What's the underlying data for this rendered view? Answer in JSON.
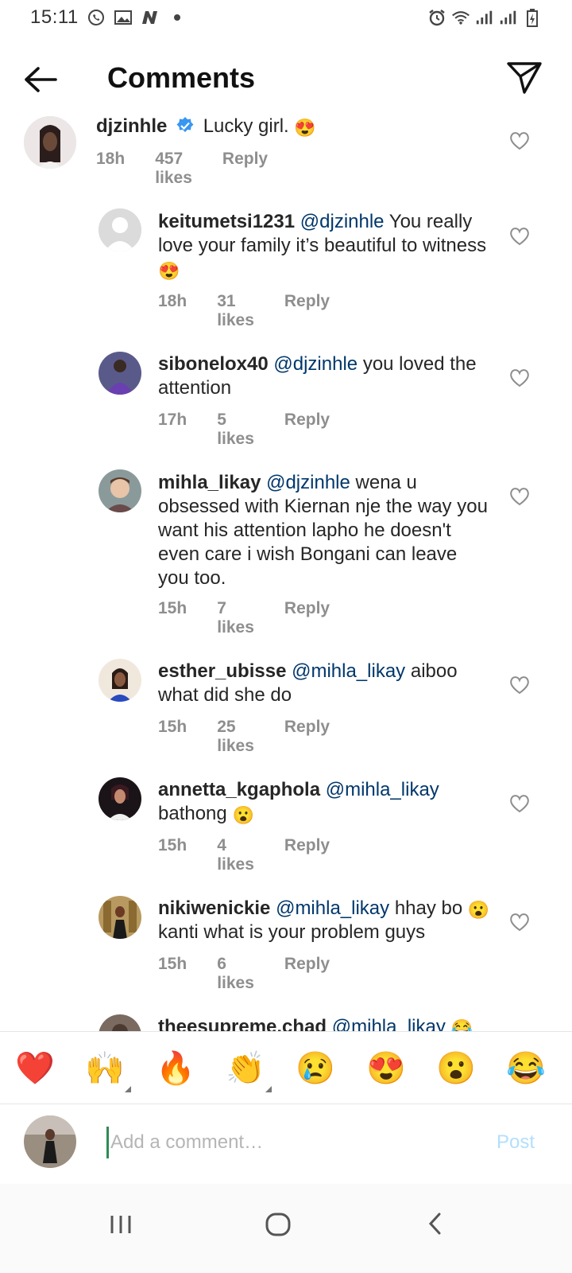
{
  "status": {
    "time": "15:11",
    "left_icons": [
      "whatsapp-icon",
      "gallery-icon",
      "news-icon",
      "dot-icon"
    ],
    "right_icons": [
      "alarm-icon",
      "wifi-icon",
      "signal-icon",
      "signal-icon",
      "battery-icon"
    ]
  },
  "header": {
    "title": "Comments"
  },
  "comments": [
    {
      "username": "djzinhle",
      "verified": true,
      "mention": "",
      "text": "Lucky girl.",
      "emoji": "😍",
      "time": "18h",
      "likes": "457 likes",
      "reply": "Reply"
    },
    {
      "username": "keitumetsi1231",
      "mention": "@djzinhle",
      "text": "You really love your family it’s beautiful to witness",
      "emoji": "😍",
      "time": "18h",
      "likes": "31 likes",
      "reply": "Reply"
    },
    {
      "username": "sibonelox40",
      "mention": "@djzinhle",
      "text": "you loved the attention",
      "emoji": "",
      "time": "17h",
      "likes": "5 likes",
      "reply": "Reply"
    },
    {
      "username": "mihla_likay",
      "mention": "@djzinhle",
      "text": "wena u obsessed with  Kiernan nje the way you want his attention lapho he doesn't even care i wish Bongani can leave you too.",
      "emoji": "",
      "time": "15h",
      "likes": "7 likes",
      "reply": "Reply"
    },
    {
      "username": "esther_ubisse",
      "mention": "@mihla_likay",
      "text": "aiboo what did she do",
      "emoji": "",
      "time": "15h",
      "likes": "25 likes",
      "reply": "Reply"
    },
    {
      "username": "annetta_kgaphola",
      "mention": "@mihla_likay",
      "text": "bathong",
      "emoji": "😮",
      "time": "15h",
      "likes": "4 likes",
      "reply": "Reply"
    },
    {
      "username": "nikiwenickie",
      "mention": "@mihla_likay",
      "text": "hhay bo",
      "emoji": "😮",
      "text2": "kanti what is your problem guys",
      "time": "15h",
      "likes": "6 likes",
      "reply": "Reply"
    },
    {
      "username": "theesupreme.chad",
      "mention": "@mihla_likay",
      "text": "",
      "emoji": "😂"
    }
  ],
  "reactions": [
    "❤️",
    "🙌",
    "🔥",
    "👏",
    "😢",
    "😍",
    "😮",
    "😂"
  ],
  "composer": {
    "placeholder": "Add a comment…",
    "post_label": "Post"
  },
  "colors": {
    "mention": "#00376b",
    "meta": "#8e8e8e",
    "post_disabled": "#b2dffc",
    "verified": "#3897f0"
  }
}
